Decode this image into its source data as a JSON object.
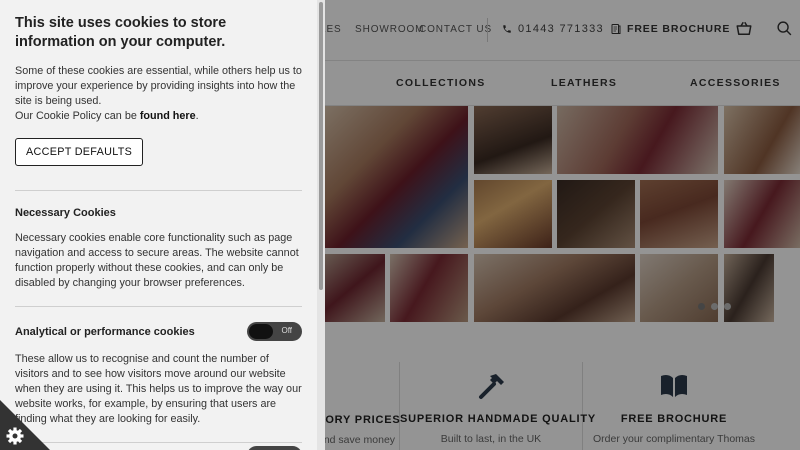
{
  "header": {
    "nav_partial": "LES",
    "nav_showroom": "SHOWROOM",
    "nav_contact": "CONTACT US",
    "phone": "01443 771333",
    "brochure": "FREE BROCHURE",
    "icons": [
      "phone-icon",
      "brochure-icon",
      "basket-icon",
      "search-icon"
    ]
  },
  "categories": {
    "collections": "COLLECTIONS",
    "leathers": "LEATHERS",
    "accessories": "ACCESSORIES"
  },
  "features": [
    {
      "title": "TORY PRICES",
      "subtitle": "and save money"
    },
    {
      "title": "SUPERIOR HANDMADE QUALITY",
      "subtitle": "Built to last, in the UK",
      "icon": "hammer-icon"
    },
    {
      "title": "FREE BROCHURE",
      "subtitle": "Order your complimentary Thomas",
      "icon": "book-icon"
    }
  ],
  "cookie": {
    "title": "This site uses cookies to store information on your computer.",
    "intro": "Some of these cookies are essential, while others help us to improve your experience by providing insights into how the site is being used.",
    "policy_prefix": "Our Cookie Policy can be ",
    "policy_link": "found here",
    "policy_suffix": ".",
    "accept_button": "ACCEPT DEFAULTS",
    "necessary_title": "Necessary Cookies",
    "necessary_text": "Necessary cookies enable core functionality such as page navigation and access to secure areas. The website cannot function properly without these cookies, and can only be disabled by changing your browser preferences.",
    "analytical_title": "Analytical or performance cookies",
    "analytical_toggle": "Off",
    "analytical_text": "These allow us to recognise and count the number of visitors and to see how visitors move around our website when they are using it. This helps us to improve the way our website works, for example, by ensuring that users are finding what they are looking for easily."
  },
  "colors": {
    "panel_bg": "#f2f2f2",
    "overlay": "rgba(0,0,0,0.42)",
    "toggle_bg": "#444444"
  }
}
